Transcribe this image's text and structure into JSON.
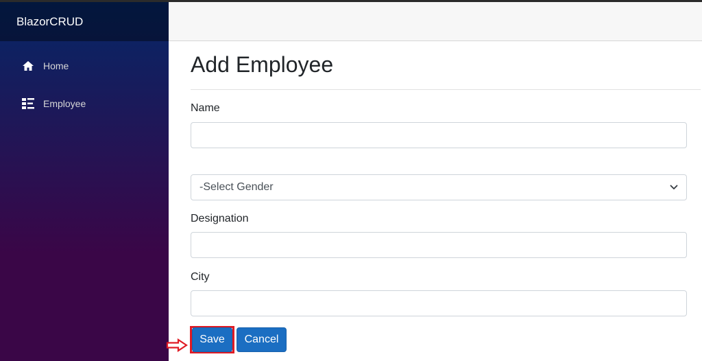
{
  "app": {
    "brand": "BlazorCRUD"
  },
  "sidebar": {
    "items": [
      {
        "label": "Home",
        "icon": "home-icon"
      },
      {
        "label": "Employee",
        "icon": "list-icon"
      }
    ]
  },
  "page": {
    "title": "Add Employee"
  },
  "form": {
    "name_label": "Name",
    "name_value": "",
    "gender_selected": "-Select Gender",
    "designation_label": "Designation",
    "designation_value": "",
    "city_label": "City",
    "city_value": ""
  },
  "actions": {
    "save_label": "Save",
    "cancel_label": "Cancel"
  },
  "colors": {
    "sidebar_top": "#052767",
    "sidebar_bottom": "#3a0647",
    "button_primary": "#1b6ec2",
    "highlight": "#e01b24"
  }
}
